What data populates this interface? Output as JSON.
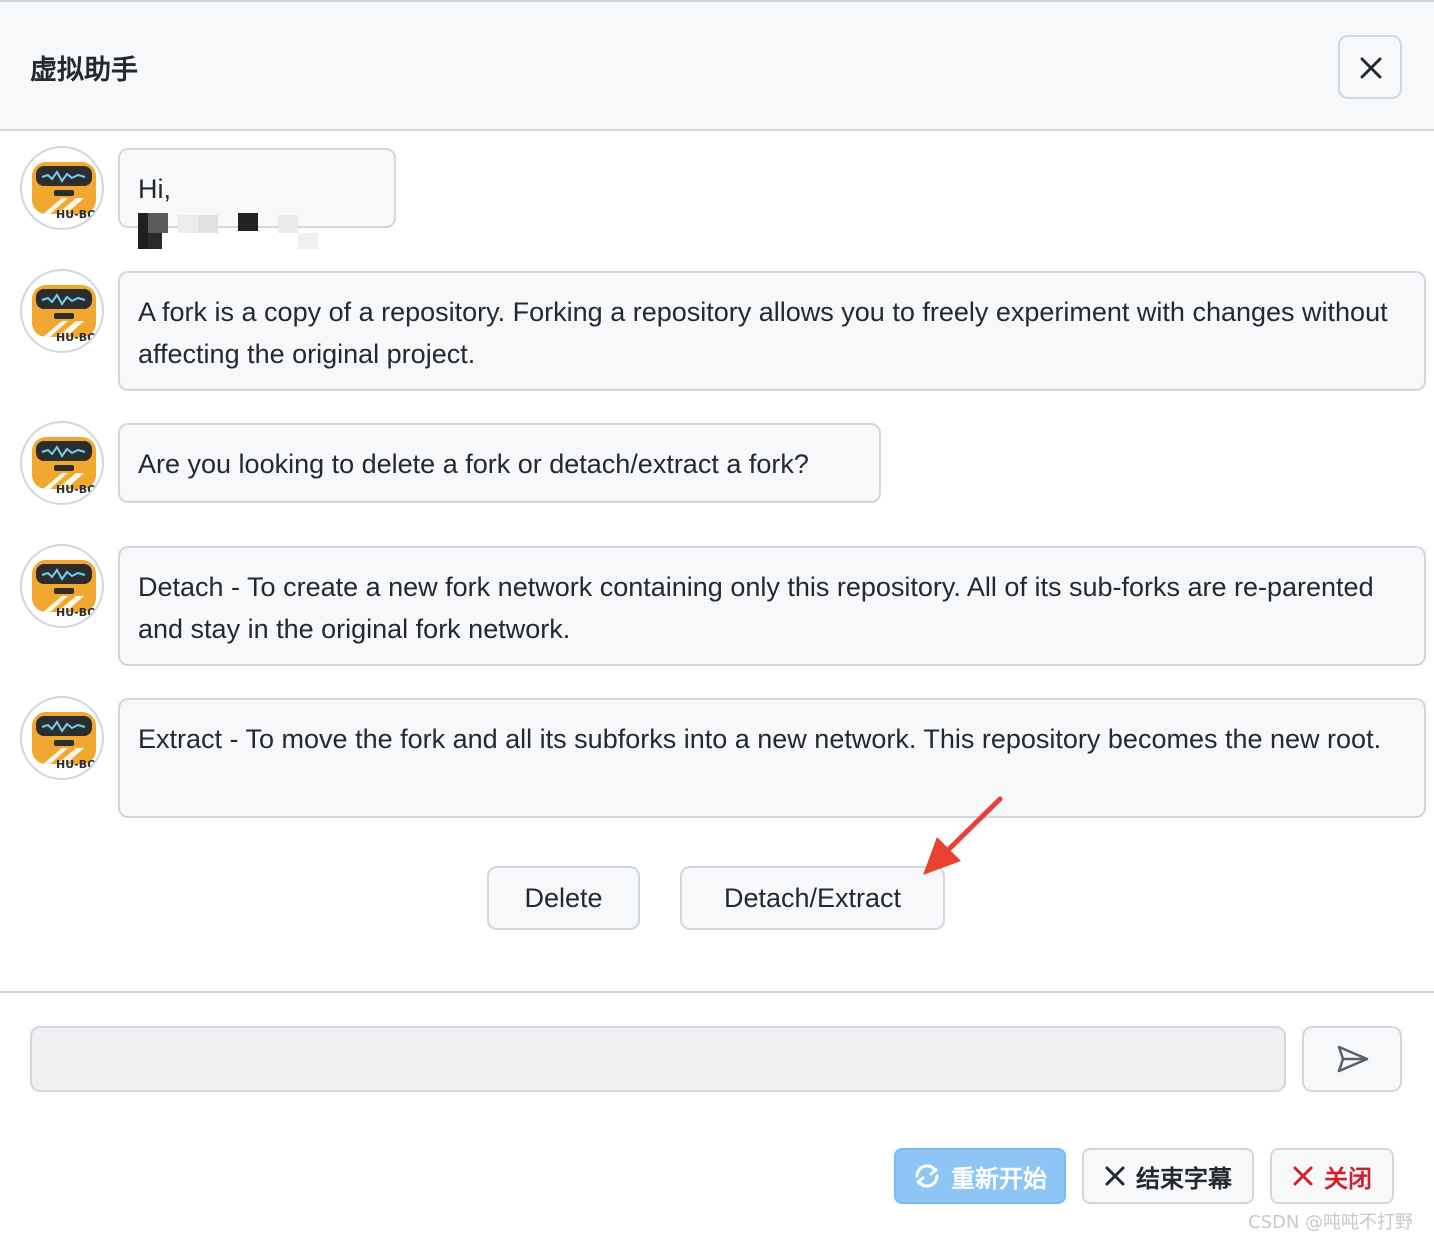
{
  "dialog": {
    "title": "虚拟助手",
    "close_icon": "close-icon"
  },
  "messages": [
    {
      "text": "Hi,"
    },
    {
      "text": "A fork is a copy of a repository. Forking a repository allows you to freely experiment with changes without affecting the original project."
    },
    {
      "text": "Are you looking to delete a fork or detach/extract a fork?"
    },
    {
      "text": "Detach - To create a new fork network containing only this repository. All of its sub-forks are re-parented and stay in the original fork network."
    },
    {
      "text": "Extract - To move the fork and all its subforks into a new network. This repository becomes the new root."
    }
  ],
  "avatar": {
    "label": "HU-BOT",
    "icon": "robot-avatar-icon"
  },
  "options": [
    {
      "label": "Delete"
    },
    {
      "label": "Detach/Extract"
    }
  ],
  "composer": {
    "placeholder": "",
    "send_icon": "send-icon"
  },
  "footer": {
    "restart_label": "重新开始",
    "end_subtitle_label": "结束字幕",
    "close_label": "关闭"
  },
  "watermark": "CSDN @吨吨不打野",
  "colors": {
    "accent_red": "#cf222e",
    "restart_blue": "#8fc5f5",
    "arrow_red": "#e8412f",
    "robot_orange": "#f0a830"
  }
}
